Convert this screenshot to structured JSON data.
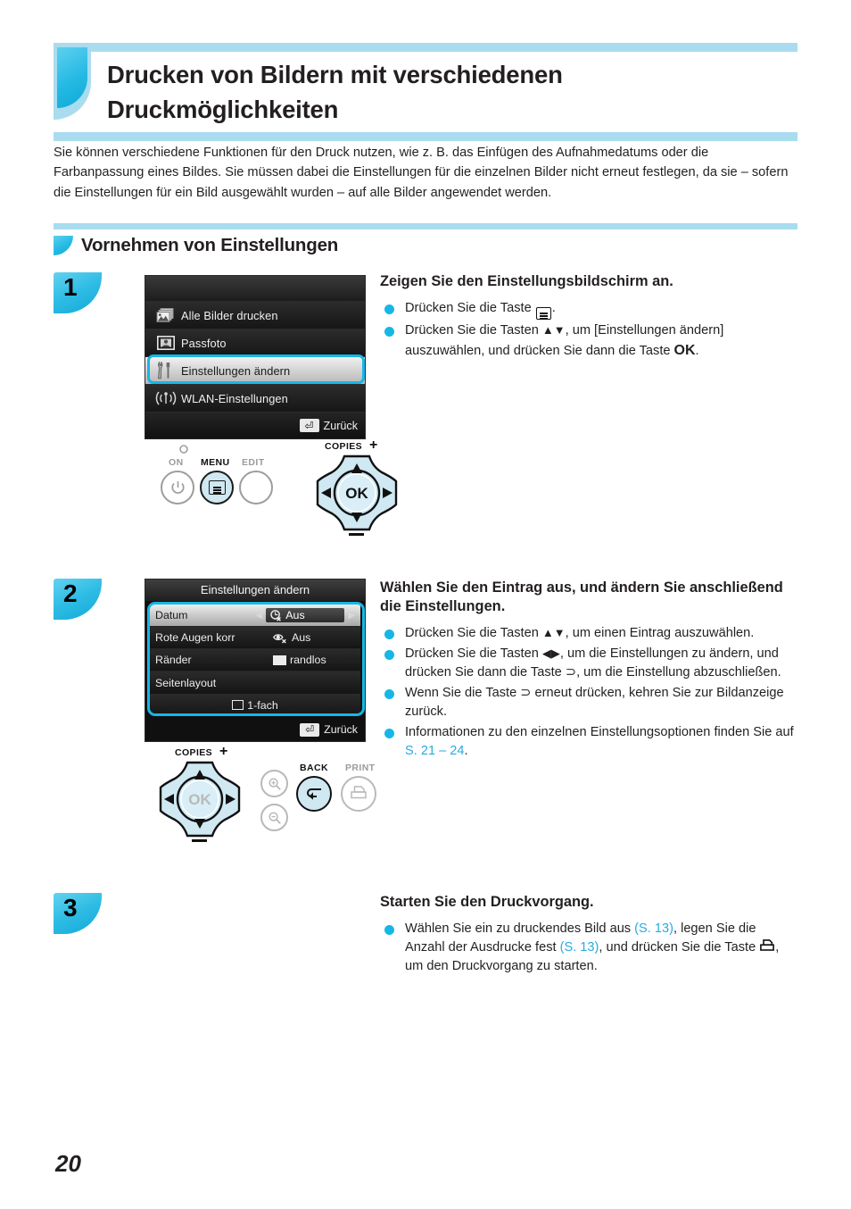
{
  "page": {
    "number": "20",
    "title": "Drucken von Bildern mit verschiedenen Druckmöglichkeiten",
    "intro": "Sie können verschiedene Funktionen für den Druck nutzen, wie z. B. das Einfügen des Aufnahmedatums oder die Farbanpassung eines Bildes. Sie müssen dabei die Einstellungen für die einzelnen Bilder nicht erneut festlegen, da sie – sofern die Einstellungen für ein Bild ausgewählt wurden – auf alle Bilder angewendet werden.",
    "section_title": "Vornehmen von Einstellungen"
  },
  "colors": {
    "accent_cyan": "#16b7e6",
    "bar_light_blue": "#a9dcef",
    "link_blue": "#29abe2",
    "text": "#231f20"
  },
  "step1": {
    "badge": "1",
    "heading": "Zeigen Sie den Einstellungsbildschirm an.",
    "bullet1_pre": "Drücken Sie die Taste ",
    "bullet1_post": ".",
    "bullet2_pre": "Drücken Sie die Tasten ",
    "bullet2_arrows": "▲▼",
    "bullet2_mid": ", um [Einstellungen ändern] auszuwählen, und drücken Sie dann die Taste ",
    "bullet2_ok": "OK",
    "bullet2_post": ".",
    "lcd": {
      "rows": [
        {
          "icon": "stacked-images-icon",
          "label": "Alle Bilder drucken",
          "selected": false
        },
        {
          "icon": "passport-photo-icon",
          "label": "Passfoto",
          "selected": false
        },
        {
          "icon": "tools-icon",
          "label": "Einstellungen ändern",
          "selected": true
        },
        {
          "icon": "wifi-icon",
          "label": "WLAN-Einstellungen",
          "selected": false
        }
      ],
      "footer_label": "Zurück",
      "footer_icon": "back-arrow-icon"
    },
    "panel": {
      "on_label": "ON",
      "menu_label": "MENU",
      "edit_label": "EDIT",
      "copies_label": "COPIES",
      "copies_plus": "+",
      "copies_minus": "−",
      "ok_label": "OK"
    }
  },
  "step2": {
    "badge": "2",
    "heading": "Wählen Sie den Eintrag aus, und ändern Sie anschließend die Einstellungen.",
    "bullets": [
      {
        "pre": "Drücken Sie die Tasten ",
        "arrows": "▲▼",
        "post": ", um einen Eintrag auszuwählen."
      },
      {
        "pre": "Drücken Sie die Tasten ",
        "arrows": "◀▶",
        "post": ", um die Einstellungen zu ändern, und drücken Sie dann die Taste ⊃, um die Einstellung abzuschließen."
      },
      {
        "pre": "Wenn Sie die Taste ⊃ erneut drücken, kehren Sie zur Bildanzeige zurück.",
        "arrows": "",
        "post": ""
      },
      {
        "pre": "Informationen zu den einzelnen Einstellungsoptionen finden Sie auf ",
        "arrows": "",
        "post": ".",
        "link": "S. 21 – 24"
      }
    ],
    "lcd": {
      "title": "Einstellungen ändern",
      "rows": [
        {
          "name": "Datum",
          "value": "Aus",
          "icon": "date-off-icon",
          "highlighted": true,
          "has_arrows": true
        },
        {
          "name": "Rote Augen korr",
          "value": "Aus",
          "icon": "redeye-off-icon",
          "highlighted": false,
          "has_arrows": false
        },
        {
          "name": "Ränder",
          "value": "randlos",
          "icon": "borderless-icon",
          "highlighted": false,
          "has_arrows": false
        },
        {
          "name": "Seitenlayout",
          "value": "",
          "icon": "",
          "highlighted": false,
          "has_arrows": false
        },
        {
          "name": "",
          "value": "1-fach",
          "icon": "layout-1up-icon",
          "highlighted": false,
          "has_arrows": false
        }
      ],
      "footer_label": "Zurück",
      "footer_icon": "back-arrow-icon"
    },
    "panel": {
      "copies_label": "COPIES",
      "copies_plus": "+",
      "copies_minus": "−",
      "ok_label": "OK",
      "back_label": "BACK",
      "print_label": "PRINT"
    }
  },
  "step3": {
    "badge": "3",
    "heading": "Starten Sie den Druckvorgang.",
    "bullet_a": "Wählen Sie ein zu druckendes Bild aus ",
    "link_a": "(S. 13)",
    "bullet_b": ", legen Sie die Anzahl der Ausdrucke fest ",
    "link_b": "(S. 13)",
    "bullet_c": ", und drücken Sie die Taste ",
    "bullet_d": ", um den Druckvorgang zu starten."
  }
}
